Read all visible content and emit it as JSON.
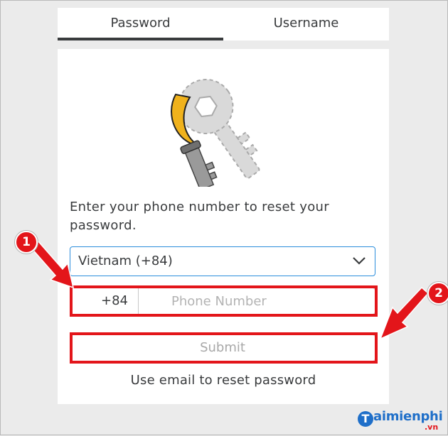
{
  "tabs": [
    {
      "label": "Password",
      "active": true
    },
    {
      "label": "Username",
      "active": false
    }
  ],
  "reset": {
    "instructions": "Enter your phone number to reset your password.",
    "country_selected": "Vietnam (+84)",
    "phone_prefix": "+84",
    "phone_placeholder": "Phone Number",
    "phone_value": "",
    "submit_label": "Submit",
    "email_link": "Use email to reset password"
  },
  "annotations": {
    "badge1": "1",
    "badge2": "2",
    "highlight_color": "#e3151a"
  },
  "watermark": {
    "initial": "T",
    "text": "aimienphi",
    "suffix": ".vn"
  },
  "icons": [
    "key-illustration",
    "chevron-down-icon"
  ]
}
